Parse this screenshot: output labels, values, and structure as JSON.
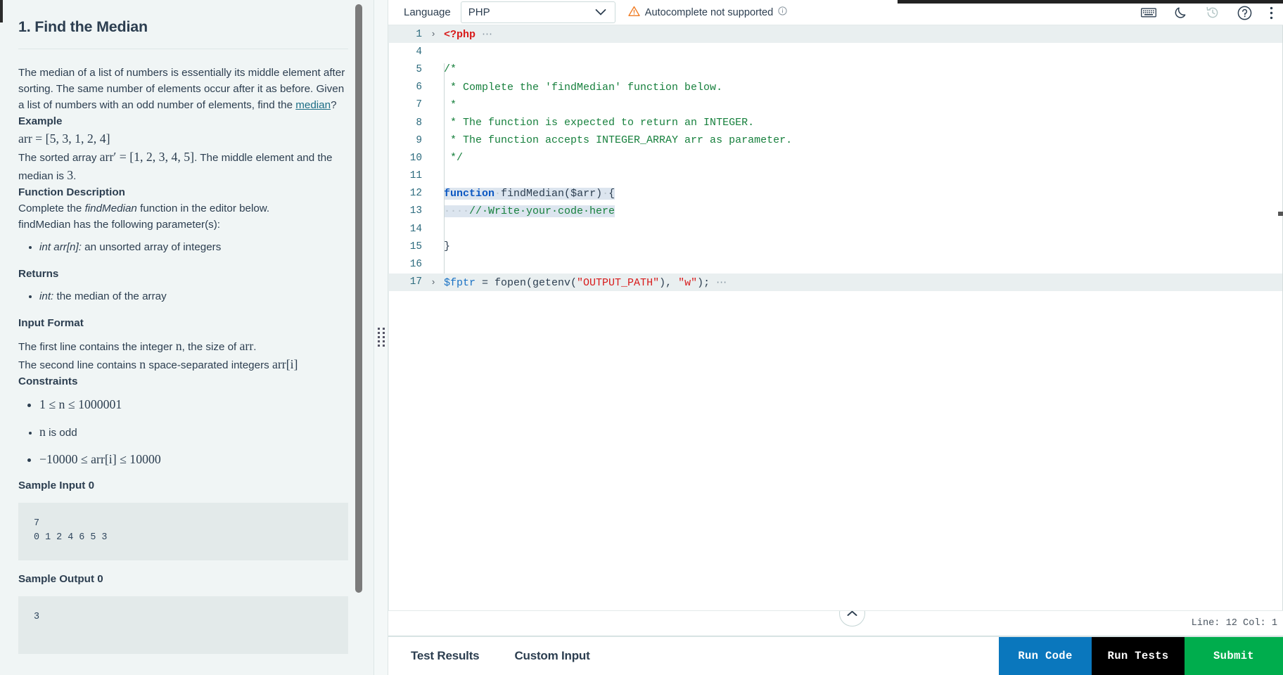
{
  "problem": {
    "title": "1. Find the Median",
    "paragraph": "The median of a list of numbers is essentially its middle element after sorting. The same number of elements occur after it as before. Given a list of numbers with an odd number of elements, find the ",
    "link_text": "median",
    "paragraph_tail": "?",
    "example_heading": "Example",
    "example_arr": "arr = [5, 3, 1, 2, 4]",
    "example_sorted_pre": "The sorted array ",
    "example_sorted_math": "arr′ = [1, 2, 3, 4, 5]",
    "example_sorted_post": ". The middle element and the median is ",
    "example_median_value": "3",
    "example_sorted_end": ".",
    "function_description_heading": "Function Description",
    "function_description_line1_pre": "Complete the ",
    "function_description_fn": "findMedian",
    "function_description_line1_post": " function in the editor below.",
    "function_description_line2": "findMedian has the following parameter(s):",
    "param_bullet_em": "int arr[n]:",
    "param_bullet_text": " an unsorted array of integers",
    "returns_heading": "Returns",
    "returns_bullet_em": "int:",
    "returns_bullet_text": " the median of the array",
    "input_format_heading": "Input Format",
    "input_format_line1_a": "The first line contains the integer ",
    "input_format_line1_n": "n",
    "input_format_line1_b": ", the size of ",
    "input_format_line1_arr": "arr",
    "input_format_line1_c": ".",
    "input_format_line2_a": "The second line contains ",
    "input_format_line2_n": "n",
    "input_format_line2_b": " space-separated integers ",
    "input_format_line2_arr": "arr[i]",
    "constraints_heading": "Constraints",
    "constraint_1": "1 ≤ n ≤ 1000001",
    "constraint_2_n": "n",
    "constraint_2_text": " is odd",
    "constraint_3": "−10000 ≤ arr[i] ≤ 10000",
    "sample_input_heading": "Sample Input 0",
    "sample_input_value": "7\n0 1 2 4 6 5 3",
    "sample_output_heading": "Sample Output 0",
    "sample_output_value": "3"
  },
  "editor_header": {
    "language_label": "Language",
    "language_value": "PHP",
    "language_options": [
      "PHP"
    ],
    "autocomplete_note": "Autocomplete not supported",
    "icons": {
      "keyboard": "keyboard-icon",
      "dark_mode": "moon-icon",
      "history": "history-icon",
      "help": "help-circle-icon",
      "more": "more-vertical-icon"
    }
  },
  "code": {
    "lines": [
      {
        "num": "1",
        "fold": "›",
        "highlight": true,
        "tokens": [
          {
            "t": "<?php",
            "c": "tk-php"
          },
          {
            "t": " ⋯",
            "c": "tk-dots"
          }
        ]
      },
      {
        "num": "4",
        "fold": "",
        "highlight": false,
        "tokens": []
      },
      {
        "num": "5",
        "fold": "",
        "highlight": false,
        "tokens": [
          {
            "t": "/*",
            "c": "tk-com"
          }
        ]
      },
      {
        "num": "6",
        "fold": "",
        "highlight": false,
        "tokens": [
          {
            "t": " * Complete the 'findMedian' function below.",
            "c": "tk-com"
          }
        ]
      },
      {
        "num": "7",
        "fold": "",
        "highlight": false,
        "tokens": [
          {
            "t": " *",
            "c": "tk-com"
          }
        ]
      },
      {
        "num": "8",
        "fold": "",
        "highlight": false,
        "tokens": [
          {
            "t": " * The function is expected to return an INTEGER.",
            "c": "tk-com"
          }
        ]
      },
      {
        "num": "9",
        "fold": "",
        "highlight": false,
        "tokens": [
          {
            "t": " * The function accepts INTEGER_ARRAY arr as parameter.",
            "c": "tk-com"
          }
        ]
      },
      {
        "num": "10",
        "fold": "",
        "highlight": false,
        "tokens": [
          {
            "t": " */",
            "c": "tk-com"
          }
        ]
      },
      {
        "num": "11",
        "fold": "",
        "highlight": false,
        "tokens": []
      },
      {
        "num": "12",
        "fold": "",
        "highlight": false,
        "selected": true,
        "tokens": [
          {
            "t": "function",
            "c": "tk-kw"
          },
          {
            "t": "·",
            "c": "ws-dot"
          },
          {
            "t": "findMedian(",
            "c": "tk-plain"
          },
          {
            "t": "$arr",
            "c": "tk-plain"
          },
          {
            "t": ")",
            "c": "tk-plain"
          },
          {
            "t": "·",
            "c": "ws-dot"
          },
          {
            "t": "{",
            "c": "tk-plain"
          }
        ]
      },
      {
        "num": "13",
        "fold": "",
        "highlight": false,
        "selected": true,
        "tokens": [
          {
            "t": "····",
            "c": "ws-dot"
          },
          {
            "t": "//·Write·your·code·here",
            "c": "tk-com"
          }
        ]
      },
      {
        "num": "14",
        "fold": "",
        "highlight": false,
        "tokens": []
      },
      {
        "num": "15",
        "fold": "",
        "highlight": false,
        "tokens": [
          {
            "t": "}",
            "c": "tk-plain"
          }
        ]
      },
      {
        "num": "16",
        "fold": "",
        "highlight": false,
        "tokens": []
      },
      {
        "num": "17",
        "fold": "›",
        "highlight": true,
        "tokens": [
          {
            "t": "$fptr",
            "c": "tk-var"
          },
          {
            "t": " = fopen(getenv(",
            "c": "tk-plain"
          },
          {
            "t": "\"OUTPUT_PATH\"",
            "c": "tk-str"
          },
          {
            "t": "), ",
            "c": "tk-plain"
          },
          {
            "t": "\"w\"",
            "c": "tk-str"
          },
          {
            "t": ");",
            "c": "tk-plain"
          },
          {
            "t": " ⋯",
            "c": "tk-dots"
          }
        ]
      }
    ]
  },
  "status": {
    "cursor_position": "Line: 12 Col: 1"
  },
  "bottom": {
    "tabs": [
      {
        "label": "Test Results",
        "name": "tab-test-results"
      },
      {
        "label": "Custom Input",
        "name": "tab-custom-input"
      }
    ],
    "buttons": [
      {
        "label": "Run Code",
        "name": "run-code-button",
        "color": "#0a77bd"
      },
      {
        "label": "Run Tests",
        "name": "run-tests-button",
        "color": "#000000"
      },
      {
        "label": "Submit",
        "name": "submit-button",
        "color": "#00ad4d"
      }
    ]
  },
  "colors": {
    "panel_bg": "#f0f5f5",
    "code_bg": "#e3eaea",
    "accent_blue": "#0a77bd",
    "accent_green": "#00ad4d",
    "text": "#2c3e50",
    "link": "#1b6d85",
    "warn": "#f07c23"
  }
}
